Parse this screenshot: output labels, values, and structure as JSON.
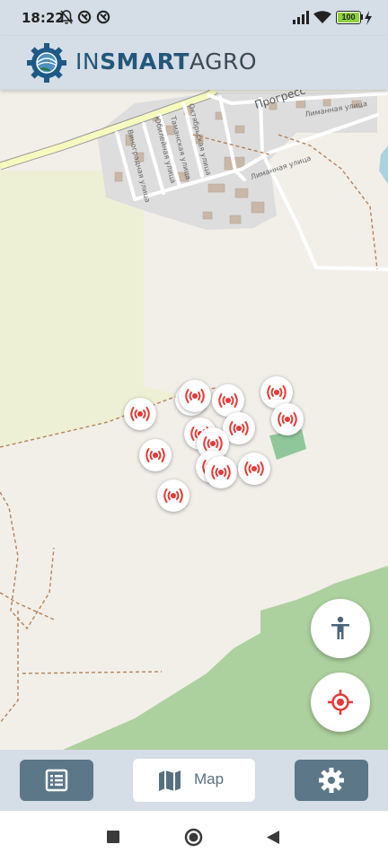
{
  "status_bar": {
    "time": "18:22",
    "battery": "100",
    "icons": [
      "bell-off-icon",
      "data-saver-icon",
      "data-saver-icon",
      "signal-icon",
      "wifi-icon",
      "battery-icon",
      "charging-icon"
    ]
  },
  "header": {
    "logo_icon": "gear-globe-icon",
    "brand_part1": "IN",
    "brand_part2": "SMART",
    "brand_part3": "AGRO",
    "brand_color": "#22577a"
  },
  "map": {
    "village_label": "Прогресс",
    "street_labels": {
      "limannaya_1": "Лиманная улица",
      "limannaya_2": "Лиманная улица",
      "vinogradnaya": "Виноградная улица",
      "yubileynaya": "Юбилейная улица",
      "tamanskaya": "Таманская улица",
      "oktyabrskaya": "Октябрьская улица"
    },
    "marker_icon": "sensor-broadcast-icon",
    "marker_color": "#e53935",
    "marker_count": 14,
    "colors": {
      "land": "#f2efe9",
      "farmland": "#eef0d5",
      "forest": "#add19e",
      "residential": "#dddddd",
      "water": "#aad3df"
    }
  },
  "fabs": {
    "accessibility_icon": "accessibility-person-icon",
    "locate_icon": "crosshair-icon"
  },
  "bottom_nav": {
    "list_icon": "list-icon",
    "map_icon": "map-icon",
    "map_label": "Map",
    "settings_icon": "gear-icon"
  },
  "system_nav": {
    "recents_icon": "square-icon",
    "home_icon": "circle-icon",
    "back_icon": "triangle-back-icon"
  }
}
